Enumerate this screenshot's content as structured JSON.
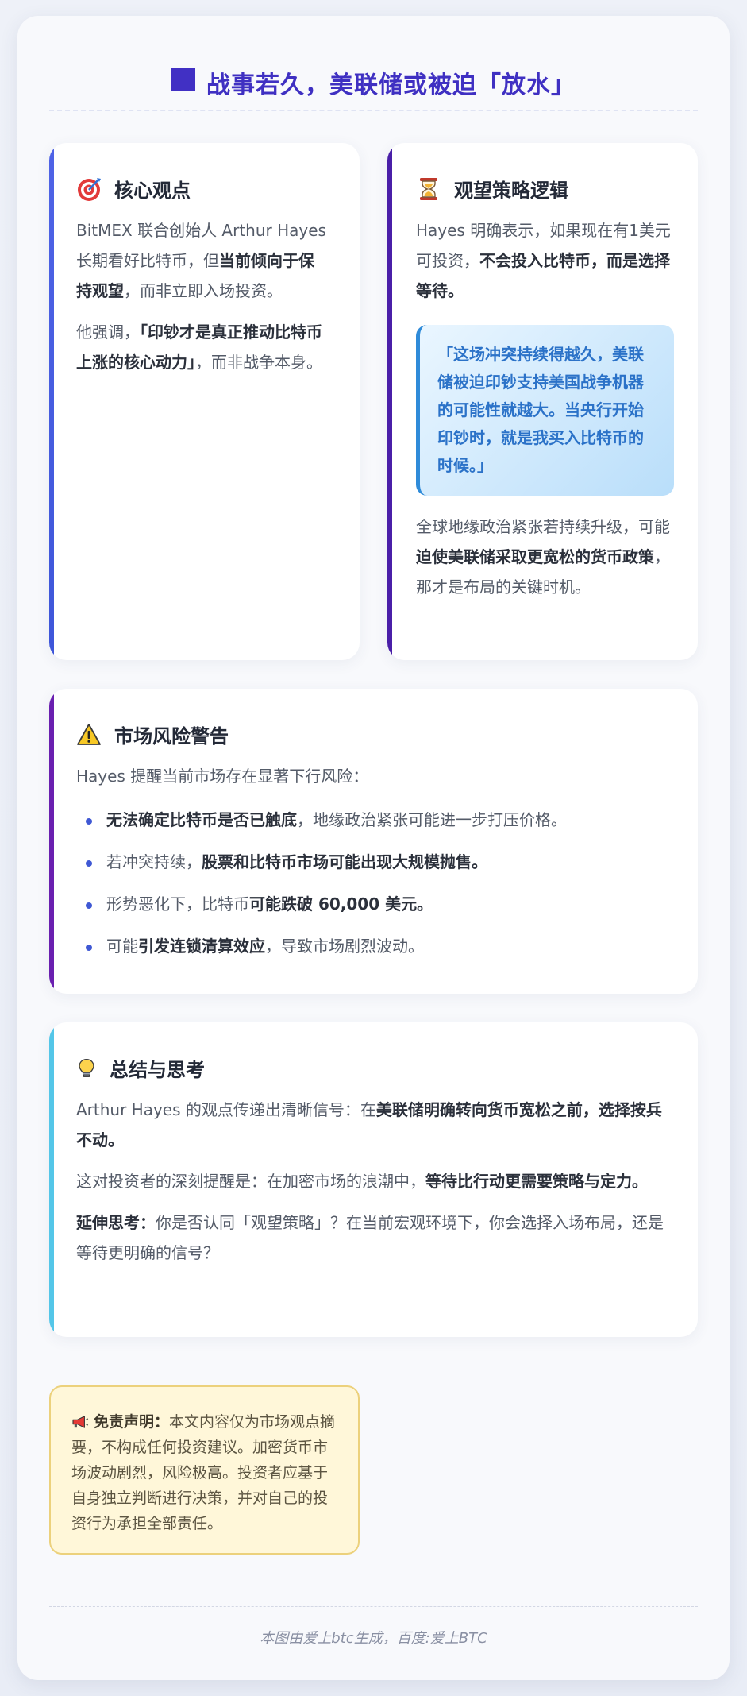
{
  "title": "战事若久，美联储或被迫「放水」",
  "colors": {
    "accent": "#3f30c2",
    "quote_text": "#2b72c8",
    "disclaimer_bg": "#fff7d9"
  },
  "core": {
    "icon": "target-icon",
    "title": "核心观点",
    "p1": [
      "BitMEX 联合创始人 Arthur Hayes 长期看好比特币，但",
      "当前倾向于保持观望",
      "，而非立即入场投资。"
    ],
    "p2": [
      "他强调，",
      "「印钞才是真正推动比特币上涨的核心动力」",
      "，而非战争本身。"
    ]
  },
  "strategy": {
    "icon": "hourglass-icon",
    "title": "观望策略逻辑",
    "p1": [
      "Hayes 明确表示，如果现在有1美元可投资，",
      "不会投入比特币，而是选择等待。"
    ],
    "quote": "「这场冲突持续得越久，美联储被迫印钞支持美国战争机器的可能性就越大。当央行开始印钞时，就是我买入比特币的时候。」",
    "p2": [
      "全球地缘政治紧张若持续升级，可能",
      "迫使美联储采取更宽松的货币政策",
      "，那才是布局的关键时机。"
    ]
  },
  "risk": {
    "icon": "warning-icon",
    "title": "市场风险警告",
    "intro": "Hayes 提醒当前市场存在显著下行风险：",
    "items": [
      [
        "",
        "无法确定比特币是否已触底",
        "，地缘政治紧张可能进一步打压价格。"
      ],
      [
        "若冲突持续，",
        "股票和比特币市场可能出现大规模抛售。",
        ""
      ],
      [
        "形势恶化下，比特币",
        "可能跌破 60,000 美元。",
        ""
      ],
      [
        "可能",
        "引发连锁清算效应",
        "，导致市场剧烈波动。"
      ]
    ]
  },
  "summary": {
    "icon": "lightbulb-icon",
    "title": "总结与思考",
    "p1": [
      "Arthur Hayes 的观点传递出清晰信号：在",
      "美联储明确转向货币宽松之前，选择按兵不动。",
      ""
    ],
    "p2": [
      "这对投资者的深刻提醒是：在加密市场的浪潮中，",
      "等待比行动更需要策略与定力。",
      ""
    ],
    "p3": [
      "",
      "延伸思考：",
      "你是否认同「观望策略」？在当前宏观环境下，你会选择入场布局，还是等待更明确的信号？"
    ]
  },
  "disclaimer": {
    "icon": "megaphone-icon",
    "label": "免责声明：",
    "text": "本文内容仅为市场观点摘要，不构成任何投资建议。加密货币市场波动剧烈，风险极高。投资者应基于自身独立判断进行决策，并对自己的投资行为承担全部责任。"
  },
  "footer": "本图由爱上btc生成，百度:爱上BTC"
}
